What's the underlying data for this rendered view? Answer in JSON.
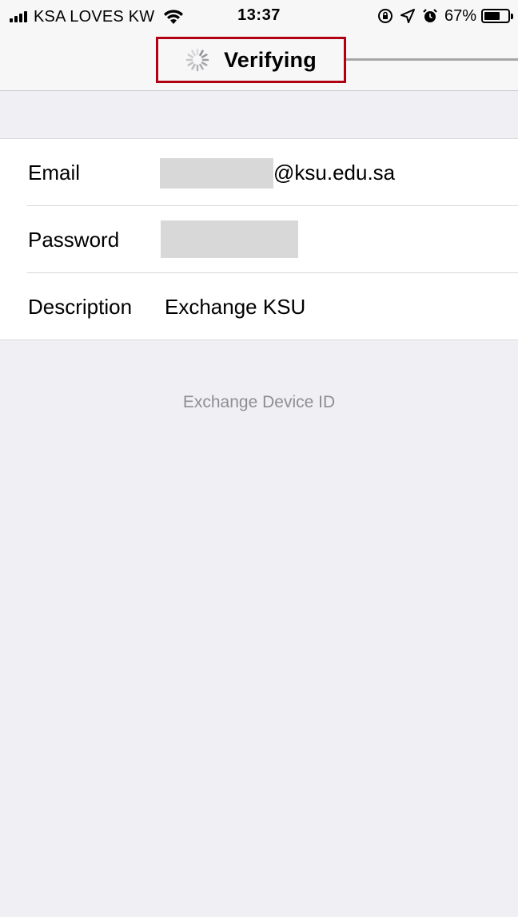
{
  "status_bar": {
    "carrier": "KSA LOVES KW",
    "time": "13:37",
    "battery_percent": "67%",
    "battery_level": 0.67,
    "icons": [
      "signal-icon",
      "wifi-icon",
      "rotation-lock-icon",
      "location-icon",
      "alarm-icon",
      "battery-icon"
    ]
  },
  "nav": {
    "title": "Verifying",
    "spinner_icon": "activity-spinner-icon",
    "highlight_color": "#b00012"
  },
  "form": {
    "email": {
      "label": "Email",
      "value": "@ksu.edu.sa"
    },
    "password": {
      "label": "Password",
      "value": ""
    },
    "description": {
      "label": "Description",
      "value": "Exchange KSU"
    }
  },
  "footer": {
    "device_id_label": "Exchange Device ID"
  }
}
